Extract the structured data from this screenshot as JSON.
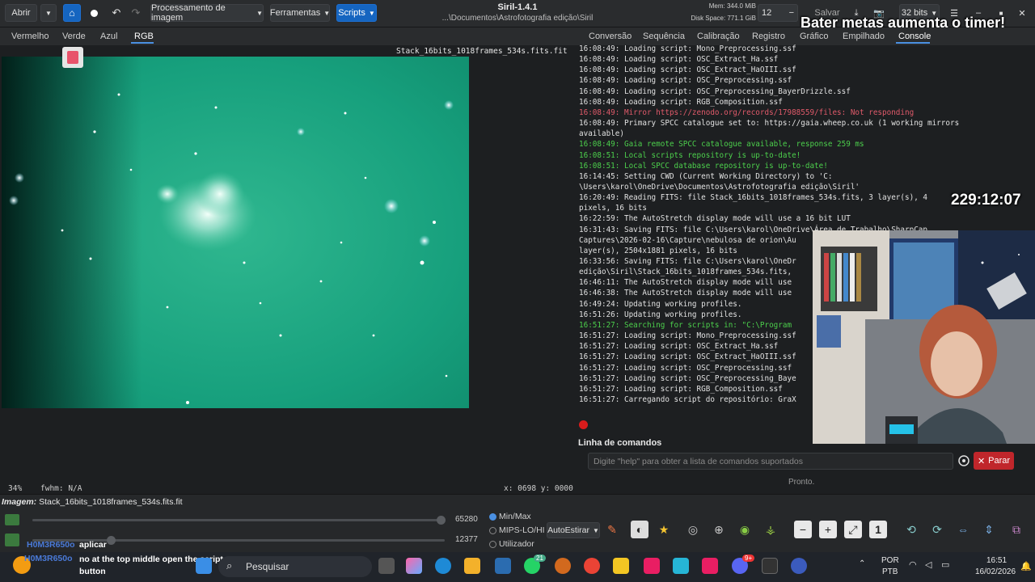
{
  "header": {
    "open_label": "Abrir",
    "menus": [
      "Processamento de imagem",
      "Ferramentas",
      "Scripts"
    ],
    "title": "Siril-1.4.1",
    "path": "...\\Documentos\\Astrofotografia edição\\Siril",
    "mem": "Mem: 344.0 MiB",
    "disk": "Disk Space: 771.1 GiB",
    "thread_count": "12",
    "save_label": "Salvar",
    "bit_depth": "32 bits",
    "overlay_text": "Bater metas aumenta o timer!"
  },
  "channels": [
    "Vermelho",
    "Verde",
    "Azul",
    "RGB"
  ],
  "image": {
    "filename": "Stack_16bits_1018frames_534s.fits.fit",
    "zoom": "34%",
    "fwhm": "fwhm: N/A",
    "coords": "x: 0698 y: 0000"
  },
  "right_tabs": [
    "Conversão",
    "Sequência",
    "Calibração",
    "Registro",
    "Gráfico",
    "Empilhado",
    "Console"
  ],
  "console_lines": [
    {
      "text": "16:08:49: Loading script: Mono_Preprocessing.ssf",
      "color": "normal"
    },
    {
      "text": "16:08:49: Loading script: OSC_Extract_Ha.ssf",
      "color": "normal"
    },
    {
      "text": "16:08:49: Loading script: OSC_Extract_HaOIII.ssf",
      "color": "normal"
    },
    {
      "text": "16:08:49: Loading script: OSC_Preprocessing.ssf",
      "color": "normal"
    },
    {
      "text": "16:08:49: Loading script: OSC_Preprocessing_BayerDrizzle.ssf",
      "color": "normal"
    },
    {
      "text": "16:08:49: Loading script: RGB_Composition.ssf",
      "color": "normal"
    },
    {
      "text": "16:08:49: Mirror https://zenodo.org/records/17988559/files: Not responding",
      "color": "red"
    },
    {
      "text": "16:08:49: Primary SPCC catalogue set to: https://gaia.wheep.co.uk (1 working mirrors",
      "color": "normal"
    },
    {
      "text": "available)",
      "color": "normal"
    },
    {
      "text": "16:08:49: Gaia remote SPCC catalogue available, response 259 ms",
      "color": "green"
    },
    {
      "text": "16:08:51: Local scripts repository is up-to-date!",
      "color": "green"
    },
    {
      "text": "16:08:51: Local SPCC database repository is up-to-date!",
      "color": "green"
    },
    {
      "text": "16:14:45: Setting CWD (Current Working Directory) to 'C:",
      "color": "normal"
    },
    {
      "text": "\\Users\\karol\\OneDrive\\Documentos\\Astrofotografia edição\\Siril'",
      "color": "normal"
    },
    {
      "text": "16:20:49: Reading FITS: file Stack_16bits_1018frames_534s.fits, 3 layer(s), 4",
      "color": "normal"
    },
    {
      "text": "pixels, 16 bits",
      "color": "normal"
    },
    {
      "text": "16:22:59: The AutoStretch display mode will use a 16 bit LUT",
      "color": "normal"
    },
    {
      "text": "16:31:43: Saving FITS: file C:\\Users\\karol\\OneDrive\\Área de Trabalho\\SharpCap",
      "color": "normal"
    },
    {
      "text": "Captures\\2026-02-16\\Capture\\nebulosa de orion\\Au",
      "color": "normal"
    },
    {
      "text": "layer(s), 2504x1881 pixels, 16 bits",
      "color": "normal"
    },
    {
      "text": "16:33:56: Saving FITS: file C:\\Users\\karol\\OneDr",
      "color": "normal"
    },
    {
      "text": "edição\\Siril\\Stack_16bits_1018frames_534s.fits,",
      "color": "normal"
    },
    {
      "text": "16:46:11: The AutoStretch display mode will use",
      "color": "normal"
    },
    {
      "text": "16:46:38: The AutoStretch display mode will use",
      "color": "normal"
    },
    {
      "text": "16:49:24: Updating working profiles.",
      "color": "normal"
    },
    {
      "text": "16:51:26: Updating working profiles.",
      "color": "normal"
    },
    {
      "text": "16:51:27: Searching for scripts in: \"C:\\Program",
      "color": "green"
    },
    {
      "text": "16:51:27: Loading script: Mono_Preprocessing.ssf",
      "color": "normal"
    },
    {
      "text": "16:51:27: Loading script: OSC_Extract_Ha.ssf",
      "color": "normal"
    },
    {
      "text": "16:51:27: Loading script: OSC_Extract_HaOIII.ssf",
      "color": "normal"
    },
    {
      "text": "16:51:27: Loading script: OSC_Preprocessing.ssf",
      "color": "normal"
    },
    {
      "text": "16:51:27: Loading script: OSC_Preprocessing_Baye",
      "color": "normal"
    },
    {
      "text": "16:51:27: Loading script: RGB_Composition.ssf",
      "color": "normal"
    },
    {
      "text": "16:51:27: Carregando script do repositório: GraX",
      "color": "normal"
    }
  ],
  "timer": "229:12:07",
  "command": {
    "label": "Linha de comandos",
    "placeholder": "Digite \"help\" para obter a lista de comandos suportados",
    "stop_label": "Parar",
    "status": "Pronto."
  },
  "bottom": {
    "image_label": "Imagem:",
    "image_name": "Stack_16bits_1018frames_534s.fits.fit",
    "high_value": "65280",
    "low_value": "12377",
    "radios": [
      "Min/Max",
      "MIPS-LO/HI",
      "Utilizador"
    ],
    "autostretch": "AutoEstirar"
  },
  "chat": [
    {
      "user": "H0M3R650o",
      "message": "aplicar"
    },
    {
      "user": "H0M3R650o",
      "message": "no at the top middle open the scripts button"
    }
  ],
  "taskbar": {
    "search": "Pesquisar",
    "lang1": "POR",
    "lang2": "PTB",
    "time": "16:51",
    "date": "16/02/2026",
    "badge_whatsapp": "21",
    "badge_discord": "9+"
  },
  "colors": {
    "accent": "#1565c0",
    "stop": "#c0262b",
    "log_red": "#e05a6a",
    "log_green": "#4ccf4c",
    "nebula_bg": "#1aa17f"
  }
}
